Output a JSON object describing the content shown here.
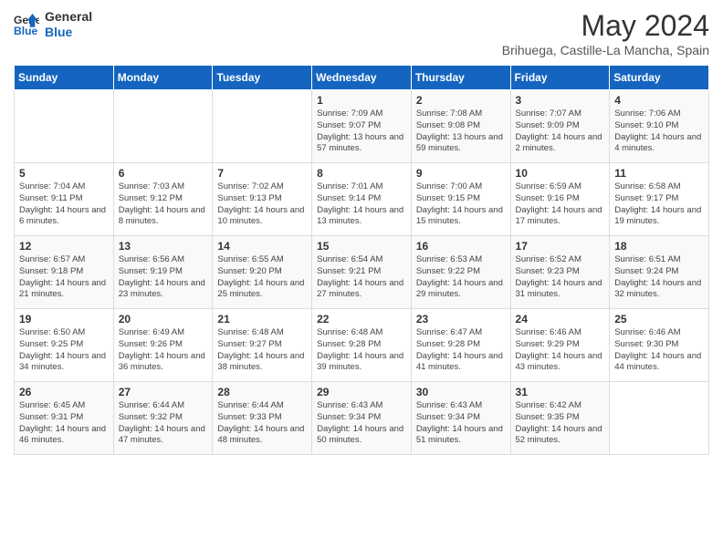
{
  "header": {
    "logo_line1": "General",
    "logo_line2": "Blue",
    "month_title": "May 2024",
    "subtitle": "Brihuega, Castille-La Mancha, Spain"
  },
  "days_of_week": [
    "Sunday",
    "Monday",
    "Tuesday",
    "Wednesday",
    "Thursday",
    "Friday",
    "Saturday"
  ],
  "weeks": [
    [
      {
        "day": "",
        "info": ""
      },
      {
        "day": "",
        "info": ""
      },
      {
        "day": "",
        "info": ""
      },
      {
        "day": "1",
        "info": "Sunrise: 7:09 AM\nSunset: 9:07 PM\nDaylight: 13 hours and 57 minutes."
      },
      {
        "day": "2",
        "info": "Sunrise: 7:08 AM\nSunset: 9:08 PM\nDaylight: 13 hours and 59 minutes."
      },
      {
        "day": "3",
        "info": "Sunrise: 7:07 AM\nSunset: 9:09 PM\nDaylight: 14 hours and 2 minutes."
      },
      {
        "day": "4",
        "info": "Sunrise: 7:06 AM\nSunset: 9:10 PM\nDaylight: 14 hours and 4 minutes."
      }
    ],
    [
      {
        "day": "5",
        "info": "Sunrise: 7:04 AM\nSunset: 9:11 PM\nDaylight: 14 hours and 6 minutes."
      },
      {
        "day": "6",
        "info": "Sunrise: 7:03 AM\nSunset: 9:12 PM\nDaylight: 14 hours and 8 minutes."
      },
      {
        "day": "7",
        "info": "Sunrise: 7:02 AM\nSunset: 9:13 PM\nDaylight: 14 hours and 10 minutes."
      },
      {
        "day": "8",
        "info": "Sunrise: 7:01 AM\nSunset: 9:14 PM\nDaylight: 14 hours and 13 minutes."
      },
      {
        "day": "9",
        "info": "Sunrise: 7:00 AM\nSunset: 9:15 PM\nDaylight: 14 hours and 15 minutes."
      },
      {
        "day": "10",
        "info": "Sunrise: 6:59 AM\nSunset: 9:16 PM\nDaylight: 14 hours and 17 minutes."
      },
      {
        "day": "11",
        "info": "Sunrise: 6:58 AM\nSunset: 9:17 PM\nDaylight: 14 hours and 19 minutes."
      }
    ],
    [
      {
        "day": "12",
        "info": "Sunrise: 6:57 AM\nSunset: 9:18 PM\nDaylight: 14 hours and 21 minutes."
      },
      {
        "day": "13",
        "info": "Sunrise: 6:56 AM\nSunset: 9:19 PM\nDaylight: 14 hours and 23 minutes."
      },
      {
        "day": "14",
        "info": "Sunrise: 6:55 AM\nSunset: 9:20 PM\nDaylight: 14 hours and 25 minutes."
      },
      {
        "day": "15",
        "info": "Sunrise: 6:54 AM\nSunset: 9:21 PM\nDaylight: 14 hours and 27 minutes."
      },
      {
        "day": "16",
        "info": "Sunrise: 6:53 AM\nSunset: 9:22 PM\nDaylight: 14 hours and 29 minutes."
      },
      {
        "day": "17",
        "info": "Sunrise: 6:52 AM\nSunset: 9:23 PM\nDaylight: 14 hours and 31 minutes."
      },
      {
        "day": "18",
        "info": "Sunrise: 6:51 AM\nSunset: 9:24 PM\nDaylight: 14 hours and 32 minutes."
      }
    ],
    [
      {
        "day": "19",
        "info": "Sunrise: 6:50 AM\nSunset: 9:25 PM\nDaylight: 14 hours and 34 minutes."
      },
      {
        "day": "20",
        "info": "Sunrise: 6:49 AM\nSunset: 9:26 PM\nDaylight: 14 hours and 36 minutes."
      },
      {
        "day": "21",
        "info": "Sunrise: 6:48 AM\nSunset: 9:27 PM\nDaylight: 14 hours and 38 minutes."
      },
      {
        "day": "22",
        "info": "Sunrise: 6:48 AM\nSunset: 9:28 PM\nDaylight: 14 hours and 39 minutes."
      },
      {
        "day": "23",
        "info": "Sunrise: 6:47 AM\nSunset: 9:28 PM\nDaylight: 14 hours and 41 minutes."
      },
      {
        "day": "24",
        "info": "Sunrise: 6:46 AM\nSunset: 9:29 PM\nDaylight: 14 hours and 43 minutes."
      },
      {
        "day": "25",
        "info": "Sunrise: 6:46 AM\nSunset: 9:30 PM\nDaylight: 14 hours and 44 minutes."
      }
    ],
    [
      {
        "day": "26",
        "info": "Sunrise: 6:45 AM\nSunset: 9:31 PM\nDaylight: 14 hours and 46 minutes."
      },
      {
        "day": "27",
        "info": "Sunrise: 6:44 AM\nSunset: 9:32 PM\nDaylight: 14 hours and 47 minutes."
      },
      {
        "day": "28",
        "info": "Sunrise: 6:44 AM\nSunset: 9:33 PM\nDaylight: 14 hours and 48 minutes."
      },
      {
        "day": "29",
        "info": "Sunrise: 6:43 AM\nSunset: 9:34 PM\nDaylight: 14 hours and 50 minutes."
      },
      {
        "day": "30",
        "info": "Sunrise: 6:43 AM\nSunset: 9:34 PM\nDaylight: 14 hours and 51 minutes."
      },
      {
        "day": "31",
        "info": "Sunrise: 6:42 AM\nSunset: 9:35 PM\nDaylight: 14 hours and 52 minutes."
      },
      {
        "day": "",
        "info": ""
      }
    ]
  ]
}
